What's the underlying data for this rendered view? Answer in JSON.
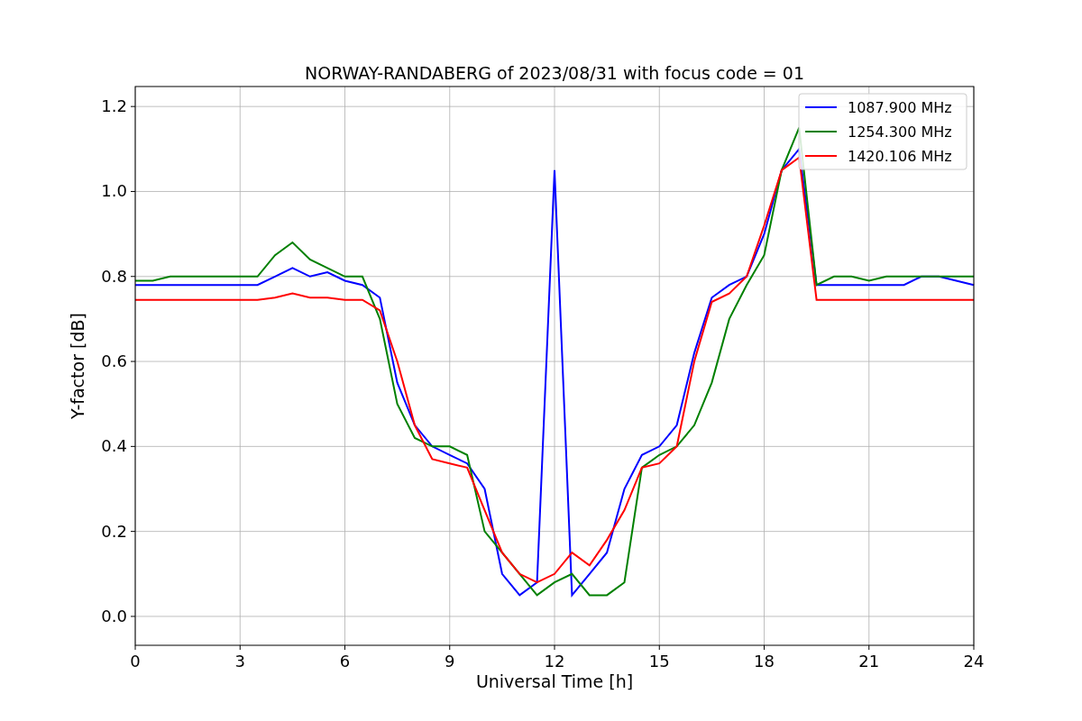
{
  "chart_data": {
    "type": "line",
    "title": "NORWAY-RANDABERG of 2023/08/31 with focus code = 01",
    "xlabel": "Universal Time [h]",
    "ylabel": "Y-factor [dB]",
    "x": [
      0,
      0.5,
      1,
      1.5,
      2,
      2.5,
      3,
      3.5,
      4,
      4.5,
      5,
      5.5,
      6,
      6.5,
      7,
      7.5,
      8,
      8.5,
      9,
      9.5,
      10,
      10.5,
      11,
      11.5,
      12,
      12.5,
      13,
      13.5,
      14,
      14.5,
      15,
      15.5,
      16,
      16.5,
      17,
      17.5,
      18,
      18.5,
      19,
      19.5,
      20,
      20.5,
      21,
      21.5,
      22,
      22.5,
      23,
      23.5,
      24
    ],
    "series": [
      {
        "name": "1087.900 MHz",
        "color": "#0000ff",
        "values": [
          0.78,
          0.78,
          0.78,
          0.78,
          0.78,
          0.78,
          0.78,
          0.78,
          0.8,
          0.82,
          0.8,
          0.81,
          0.79,
          0.78,
          0.75,
          0.55,
          0.45,
          0.4,
          0.38,
          0.36,
          0.3,
          0.1,
          0.05,
          0.08,
          1.05,
          0.05,
          0.1,
          0.15,
          0.3,
          0.38,
          0.4,
          0.45,
          0.62,
          0.75,
          0.78,
          0.8,
          0.9,
          1.05,
          1.1,
          0.78,
          0.78,
          0.78,
          0.78,
          0.78,
          0.78,
          0.8,
          0.8,
          0.79,
          0.78
        ]
      },
      {
        "name": "1254.300 MHz",
        "color": "#008000",
        "values": [
          0.79,
          0.79,
          0.8,
          0.8,
          0.8,
          0.8,
          0.8,
          0.8,
          0.85,
          0.88,
          0.84,
          0.82,
          0.8,
          0.8,
          0.7,
          0.5,
          0.42,
          0.4,
          0.4,
          0.38,
          0.2,
          0.15,
          0.1,
          0.05,
          0.08,
          0.1,
          0.05,
          0.05,
          0.08,
          0.35,
          0.38,
          0.4,
          0.45,
          0.55,
          0.7,
          0.78,
          0.85,
          1.05,
          1.15,
          0.78,
          0.8,
          0.8,
          0.79,
          0.8,
          0.8,
          0.8,
          0.8,
          0.8,
          0.8
        ]
      },
      {
        "name": "1420.106 MHz",
        "color": "#ff0000",
        "values": [
          0.745,
          0.745,
          0.745,
          0.745,
          0.745,
          0.745,
          0.745,
          0.745,
          0.75,
          0.76,
          0.75,
          0.75,
          0.745,
          0.745,
          0.72,
          0.6,
          0.45,
          0.37,
          0.36,
          0.35,
          0.25,
          0.15,
          0.1,
          0.08,
          0.1,
          0.15,
          0.12,
          0.18,
          0.25,
          0.35,
          0.36,
          0.4,
          0.6,
          0.74,
          0.76,
          0.8,
          0.92,
          1.05,
          1.08,
          0.745,
          0.745,
          0.745,
          0.745,
          0.745,
          0.745,
          0.745,
          0.745,
          0.745,
          0.745
        ]
      }
    ],
    "grid": true,
    "legend": true,
    "xlim": [
      0,
      24
    ],
    "ylim": [
      -0.068,
      1.247
    ],
    "xticks": [
      0,
      3,
      6,
      9,
      12,
      15,
      18,
      21,
      24
    ],
    "yticks": [
      {
        "value": 0,
        "label": "0.0"
      },
      {
        "value": 0.2,
        "label": "0.2"
      },
      {
        "value": 0.4,
        "label": "0.4"
      },
      {
        "value": 0.6,
        "label": "0.6"
      },
      {
        "value": 0.8,
        "label": "0.8"
      },
      {
        "value": 1.0,
        "label": "1.0"
      },
      {
        "value": 1.2,
        "label": "1.2"
      }
    ]
  }
}
